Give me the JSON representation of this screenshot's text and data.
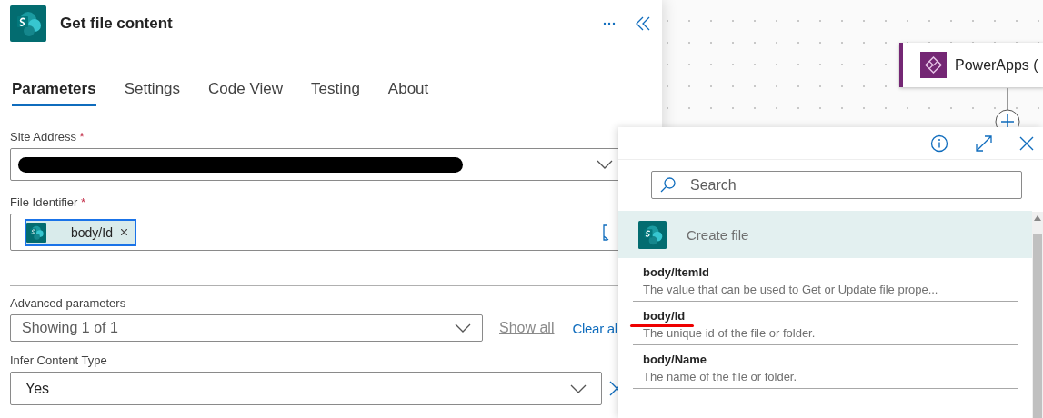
{
  "action": {
    "title": "Get file content"
  },
  "tabs": [
    {
      "label": "Parameters",
      "selected": true
    },
    {
      "label": "Settings",
      "selected": false
    },
    {
      "label": "Code View",
      "selected": false
    },
    {
      "label": "Testing",
      "selected": false
    },
    {
      "label": "About",
      "selected": false
    }
  ],
  "site_address": {
    "label": "Site Address",
    "required_mark": "*",
    "redacted": true
  },
  "file_identifier": {
    "label": "File Identifier",
    "required_mark": "*",
    "tokens": [
      {
        "label": "body/Id"
      }
    ]
  },
  "advanced_parameters": {
    "label": "Advanced parameters",
    "value": "Showing 1 of 1",
    "show_all": "Show all",
    "clear_all": "Clear al"
  },
  "infer_content_type": {
    "label": "Infer Content Type",
    "value": "Yes"
  },
  "canvas": {
    "node": {
      "title": "PowerApps ("
    }
  },
  "picker": {
    "search": {
      "placeholder": "Search"
    },
    "group": {
      "title": "Create file"
    },
    "items": [
      {
        "name": "body/ItemId",
        "description": "The value that can be used to Get or Update file prope...",
        "underlined": false
      },
      {
        "name": "body/Id",
        "description": "The unique id of the file or folder.",
        "underlined": true
      },
      {
        "name": "body/Name",
        "description": "The name of the file or folder.",
        "underlined": false
      }
    ]
  }
}
